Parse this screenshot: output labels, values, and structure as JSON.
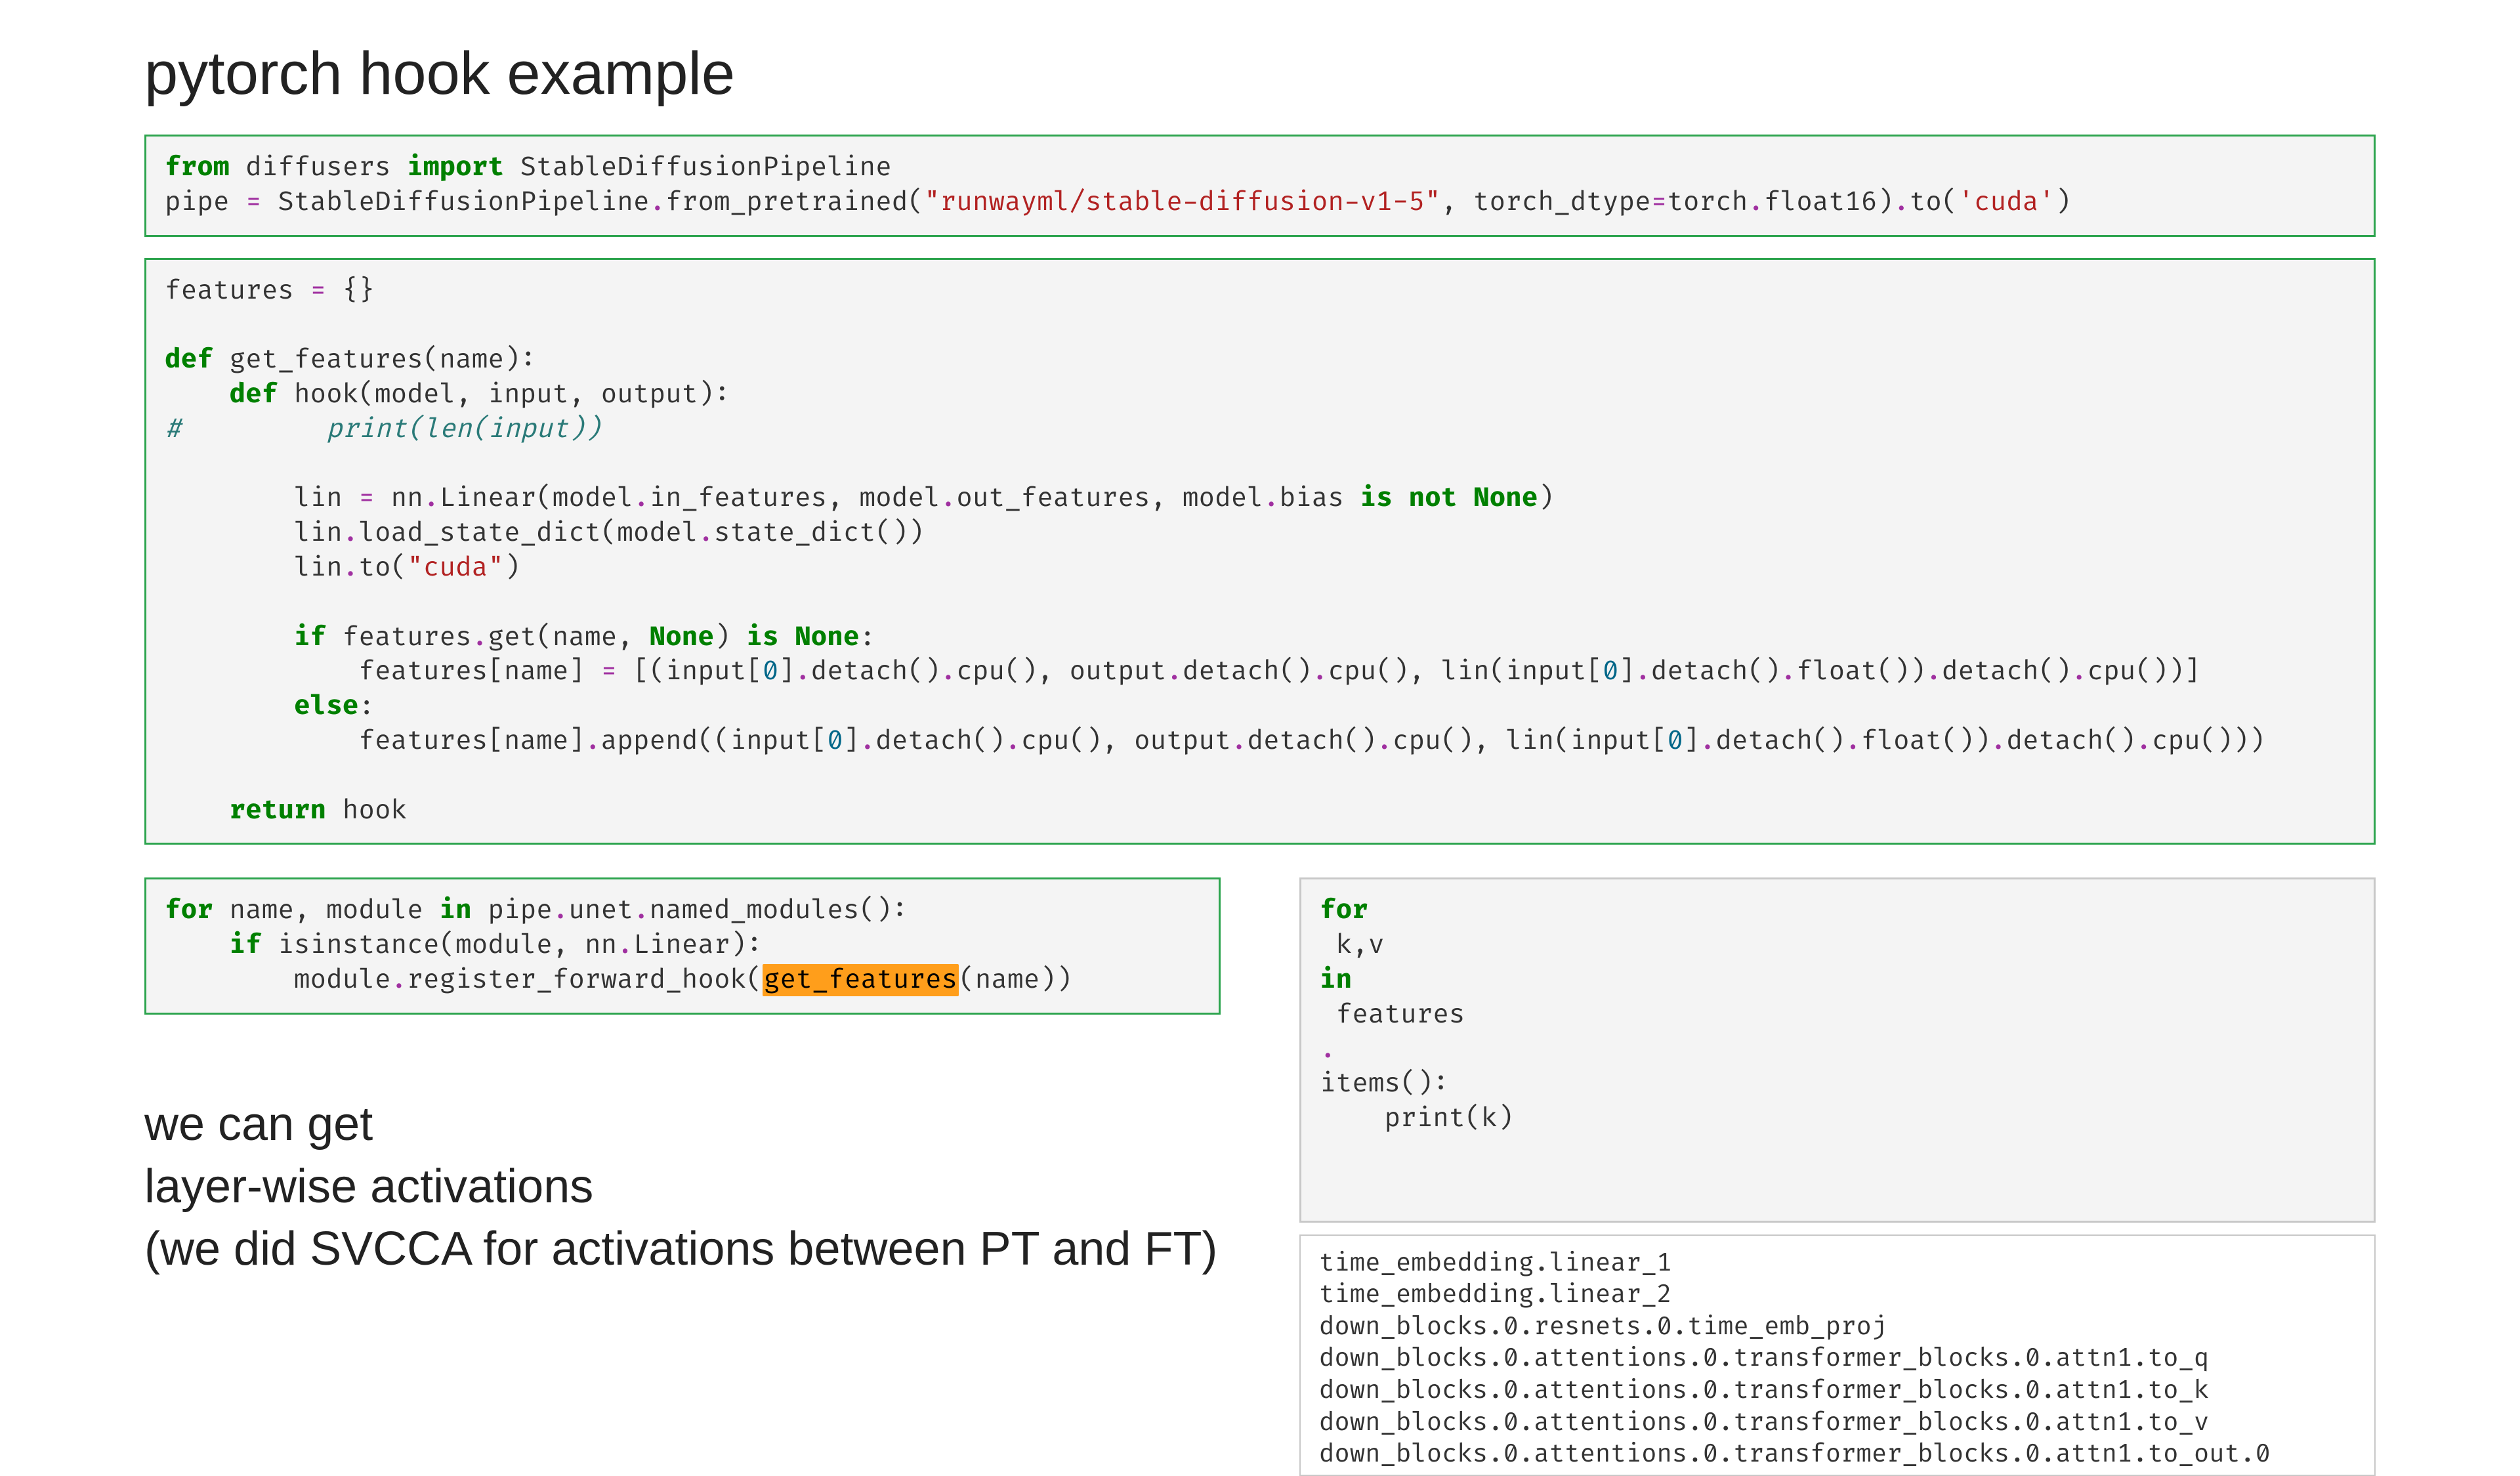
{
  "title": "pytorch hook example",
  "caption_line1": "we can get",
  "caption_line2": "layer-wise activations",
  "caption_line3": "(we did SVCCA for activations between PT and FT)",
  "code1": {
    "l1a": "from",
    "l1b": " diffusers ",
    "l1c": "import",
    "l1d": " StableDiffusionPipeline",
    "l2a": "pipe ",
    "l2b": "=",
    "l2c": " StableDiffusionPipeline",
    "l2d": ".",
    "l2e": "from_pretrained(",
    "l2f": "\"runwayml/stable-diffusion-v1-5\"",
    "l2g": ", torch_dtype",
    "l2h": "=",
    "l2i": "torch",
    "l2j": ".",
    "l2k": "float16)",
    "l2l": ".",
    "l2m": "to(",
    "l2n": "'cuda'",
    "l2o": ")"
  },
  "code2": {
    "l1": "features ",
    "l1b": "=",
    "l1c": " {}",
    "l3a": "def",
    "l3b": " get_features(name):",
    "l4a": "    ",
    "l4b": "def",
    "l4c": " hook(model, input, output):",
    "l5a": "#         print(len(input))",
    "l7a": "        lin ",
    "l7b": "=",
    "l7c": " nn",
    "l7d": ".",
    "l7e": "Linear(model",
    "l7f": ".",
    "l7g": "in_features, model",
    "l7h": ".",
    "l7i": "out_features, model",
    "l7j": ".",
    "l7k": "bias ",
    "l7l": "is not",
    "l7m": " ",
    "l7n": "None",
    "l7o": ")",
    "l8a": "        lin",
    "l8b": ".",
    "l8c": "load_state_dict(model",
    "l8d": ".",
    "l8e": "state_dict())",
    "l9a": "        lin",
    "l9b": ".",
    "l9c": "to(",
    "l9d": "\"cuda\"",
    "l9e": ")",
    "l11a": "        ",
    "l11b": "if",
    "l11c": " features",
    "l11d": ".",
    "l11e": "get(name, ",
    "l11f": "None",
    "l11g": ") ",
    "l11h": "is",
    "l11i": " ",
    "l11j": "None",
    "l11k": ":",
    "l12a": "            features[name] ",
    "l12b": "=",
    "l12c": " [(input[",
    "l12d": "0",
    "l12e": "]",
    "l12f": ".",
    "l12g": "detach()",
    "l12h": ".",
    "l12i": "cpu(), output",
    "l12j": ".",
    "l12k": "detach()",
    "l12l": ".",
    "l12m": "cpu(), lin(input[",
    "l12n": "0",
    "l12o": "]",
    "l12p": ".",
    "l12q": "detach()",
    "l12r": ".",
    "l12s": "float())",
    "l12t": ".",
    "l12u": "detach()",
    "l12v": ".",
    "l12w": "cpu())]",
    "l13a": "        ",
    "l13b": "else",
    "l13c": ":",
    "l14a": "            features[name]",
    "l14b": ".",
    "l14c": "append((input[",
    "l14d": "0",
    "l14e": "]",
    "l14f": ".",
    "l14g": "detach()",
    "l14h": ".",
    "l14i": "cpu(), output",
    "l14j": ".",
    "l14k": "detach()",
    "l14l": ".",
    "l14m": "cpu(), lin(input[",
    "l14n": "0",
    "l14o": "]",
    "l14p": ".",
    "l14q": "detach()",
    "l14r": ".",
    "l14s": "float())",
    "l14t": ".",
    "l14u": "detach()",
    "l14v": ".",
    "l14w": "cpu()))",
    "l16a": "    ",
    "l16b": "return",
    "l16c": " hook"
  },
  "code3": {
    "l1a": "for",
    "l1b": " name, module ",
    "l1c": "in",
    "l1d": " pipe",
    "l1e": ".",
    "l1f": "unet",
    "l1g": ".",
    "l1h": "named_modules():",
    "l2a": "    ",
    "l2b": "if",
    "l2c": " isinstance(module, nn",
    "l2d": ".",
    "l2e": "Linear):",
    "l3a": "        module",
    "l3b": ".",
    "l3c": "register_forward_hook(",
    "l3d": "get_features",
    "l3e": "(name))"
  },
  "code4": {
    "l1a": "for",
    "l1b": " k,v ",
    "l1c": "in",
    "l1d": " features",
    "l1e": ".",
    "l1f": "items():",
    "l2a": "    print(k)"
  },
  "output_lines": [
    "time_embedding.linear_1",
    "time_embedding.linear_2",
    "down_blocks.0.resnets.0.time_emb_proj",
    "down_blocks.0.attentions.0.transformer_blocks.0.attn1.to_q",
    "down_blocks.0.attentions.0.transformer_blocks.0.attn1.to_k",
    "down_blocks.0.attentions.0.transformer_blocks.0.attn1.to_v",
    "down_blocks.0.attentions.0.transformer_blocks.0.attn1.to_out.0"
  ]
}
